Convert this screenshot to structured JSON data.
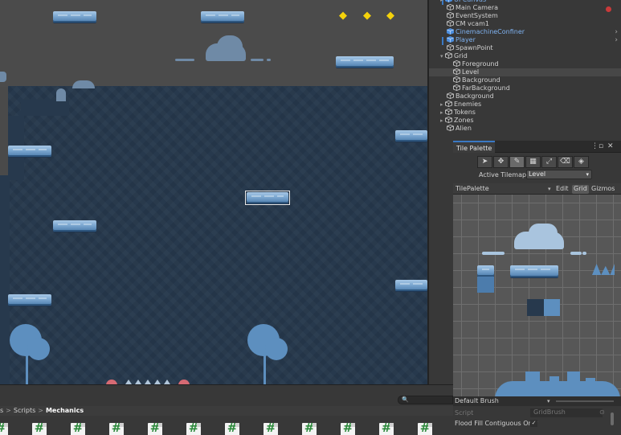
{
  "scene": {
    "gem_glyph": "◆",
    "colors": {
      "water": "#27394d",
      "platform": "#7ba7d0",
      "gem": "#f5d20b",
      "tree": "#5d8fbf"
    }
  },
  "hierarchy": {
    "items": [
      {
        "label": "UI Canvas",
        "type": "prefab-icon"
      },
      {
        "label": "Main Camera",
        "type": "object-icon"
      },
      {
        "label": "EventSystem",
        "type": "object-icon"
      },
      {
        "label": "CM vcam1",
        "type": "object-icon"
      },
      {
        "label": "CinemachineConfiner",
        "type": "prefab-icon"
      },
      {
        "label": "Player",
        "type": "prefab-icon"
      },
      {
        "label": "SpawnPoint",
        "type": "object-icon"
      },
      {
        "label": "Grid",
        "type": "object-icon"
      },
      {
        "label": "Foreground",
        "type": "object-icon"
      },
      {
        "label": "Level",
        "type": "object-icon"
      },
      {
        "label": "Background",
        "type": "object-icon"
      },
      {
        "label": "FarBackground",
        "type": "object-icon"
      },
      {
        "label": "Background",
        "type": "object-icon"
      },
      {
        "label": "Enemies",
        "type": "object-icon"
      },
      {
        "label": "Tokens",
        "type": "object-icon"
      },
      {
        "label": "Zones",
        "type": "object-icon"
      },
      {
        "label": "Alien",
        "type": "object-icon"
      }
    ]
  },
  "tile_palette": {
    "tab_label": "Tile Palette",
    "window_menu": "⋮",
    "window_max": "▫",
    "window_close": "✕",
    "tools": [
      {
        "name": "select-tool-icon",
        "glyph": "➤"
      },
      {
        "name": "move-tool-icon",
        "glyph": "✥"
      },
      {
        "name": "paint-brush-icon",
        "glyph": "✎"
      },
      {
        "name": "box-fill-icon",
        "glyph": "▦"
      },
      {
        "name": "pick-tool-icon",
        "glyph": "⤢"
      },
      {
        "name": "eraser-icon",
        "glyph": "⌫"
      },
      {
        "name": "flood-fill-icon",
        "glyph": "◈"
      }
    ],
    "active_tilemap_label": "Active Tilemap",
    "active_tilemap_value": "Level",
    "palette_name": "TilePalette",
    "edit_label": "Edit",
    "grid_label": "Grid",
    "gizmos_label": "Gizmos",
    "brush_name": "Default Brush",
    "script_label": "Script",
    "script_value": "GridBrush",
    "flood_fill_label": "Flood Fill Contiguous Only",
    "flood_fill_check": "✓",
    "dropdown_arrow": "▾"
  },
  "project": {
    "breadcrumb_start": "s",
    "breadcrumb_middle": "Scripts",
    "breadcrumb_end": "Mechanics",
    "search_glyph": "🔍",
    "asset_count": 14
  }
}
